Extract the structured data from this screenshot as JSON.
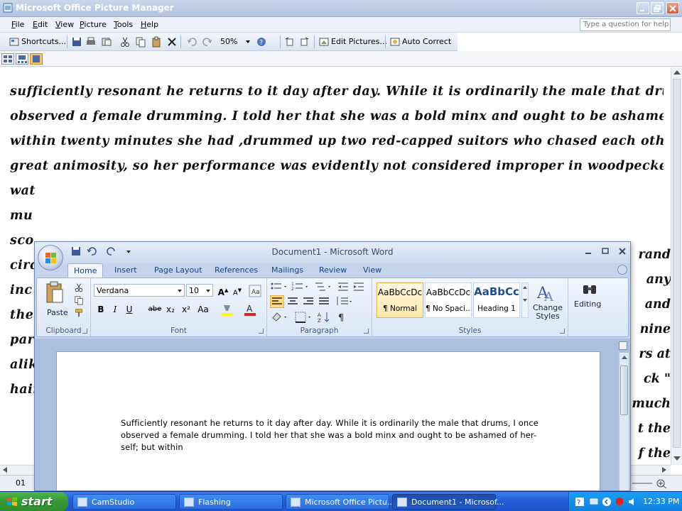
{
  "picture_manager": {
    "title": "Microsoft Office Picture Manager",
    "menu": [
      "File",
      "Edit",
      "View",
      "Picture",
      "Tools",
      "Help"
    ],
    "question_placeholder": "Type a question for help",
    "toolbar": {
      "shortcuts_label": "Shortcuts...",
      "zoom_value": "50%",
      "edit_pictures_label": "Edit Pictures...",
      "auto_correct_label": "Auto Correct"
    },
    "script_lines": [
      "sufficiently resonant he returns to it day after day. While it is ordinarily the male that drums, I once",
      "observed a female drumming. I told her that she was a bold minx and ought to be ashamed of her- self; but",
      "within twenty minutes she had ,drummed up two red-capped suitors who  chased each other about with",
      "great animosity, so her performance was evidently  not considered improper in woodpecker  society. I have",
      "wat",
      "mu",
      "sco",
      "circ",
      "inc",
      "the",
      "par",
      "alik",
      "hair"
    ],
    "script_right_fragments": [
      "rand",
      "any",
      "and",
      "nine",
      "rs at",
      "ck \"",
      "much",
      "t the",
      "f the"
    ],
    "status_count": "01"
  },
  "word": {
    "title": "Document1 - Microsoft Word",
    "tabs": [
      "Home",
      "Insert",
      "Page Layout",
      "References",
      "Mailings",
      "Review",
      "View"
    ],
    "active_tab": "Home",
    "clipboard": {
      "paste_label": "Paste",
      "group_label": "Clipboard"
    },
    "font": {
      "name_value": "Verdana",
      "size_value": "10",
      "group_label": "Font",
      "bold": "B",
      "italic": "I",
      "underline": "U",
      "strike": "abe",
      "subscript": "x₂",
      "superscript": "x²",
      "change_case": "Aa"
    },
    "paragraph": {
      "group_label": "Paragraph"
    },
    "styles": {
      "group_label": "Styles",
      "items": [
        {
          "sample": "AaBbCcDc",
          "name": "¶ Normal"
        },
        {
          "sample": "AaBbCcDc",
          "name": "¶ No Spaci..."
        },
        {
          "sample": "AaBbCc",
          "name": "Heading 1"
        }
      ],
      "change_styles_label": "Change Styles"
    },
    "editing": {
      "label": "Editing"
    },
    "document_text": "Sufficiently resonant he returns to it day after day. While it is ordinarily the male that drums, I once observed a female drumming. I told her that she was a bold minx and ought to be ashamed of her- self; but within"
  },
  "taskbar": {
    "start_label": "start",
    "tasks": [
      {
        "label": "CamStudio",
        "active": false
      },
      {
        "label": "Flashing",
        "active": false
      },
      {
        "label": "Microsoft Office Pictu...",
        "active": false
      },
      {
        "label": "Document1 - Microsof...",
        "active": true
      }
    ],
    "clock": "12:33 PM"
  },
  "colors": {
    "xp_blue": "#245edb",
    "start_green": "#389b36",
    "word_ribbon": "#dbe6f6",
    "style_selected": "#ffe7a8"
  }
}
